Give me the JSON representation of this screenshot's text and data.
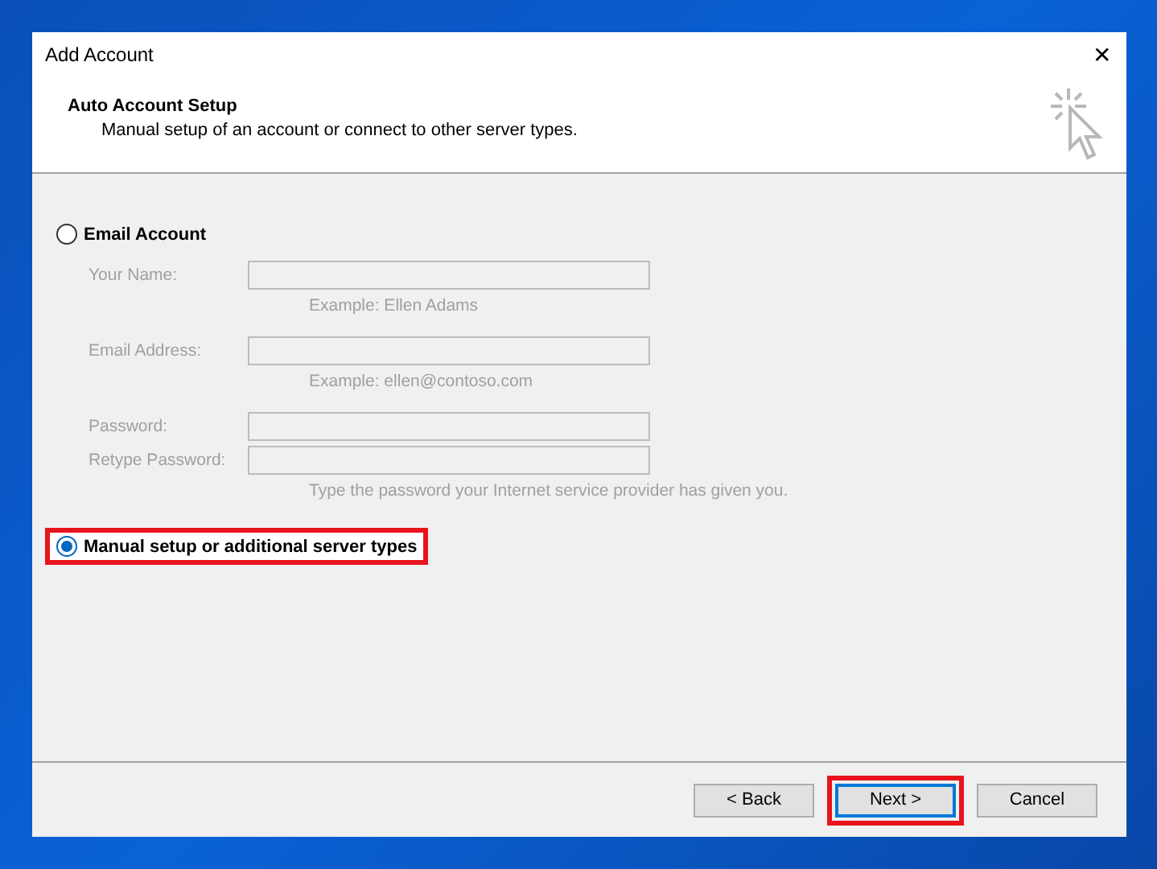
{
  "window": {
    "title": "Add Account",
    "close": "✕"
  },
  "header": {
    "title": "Auto Account Setup",
    "subtitle": "Manual setup of an account or connect to other server types."
  },
  "options": [
    {
      "label": "Email Account",
      "selected": false,
      "fields": [
        {
          "label": "Your Name:",
          "disabled": true,
          "hint": "Example: Ellen Adams"
        },
        {
          "label": "Email Address:",
          "disabled": true,
          "hint": "Example: ellen@contoso.com"
        },
        {
          "label": "Password:",
          "disabled": true
        },
        {
          "label": "Retype Password:",
          "disabled": true,
          "hint": "Type the password your Internet service provider has given you."
        }
      ]
    },
    {
      "label": "Manual setup or additional server types",
      "selected": true,
      "highlighted": true
    }
  ],
  "buttons": [
    {
      "label": "< Back",
      "default": false
    },
    {
      "label": "Next >",
      "default": true,
      "highlighted": true
    },
    {
      "label": "Cancel",
      "default": false
    }
  ]
}
